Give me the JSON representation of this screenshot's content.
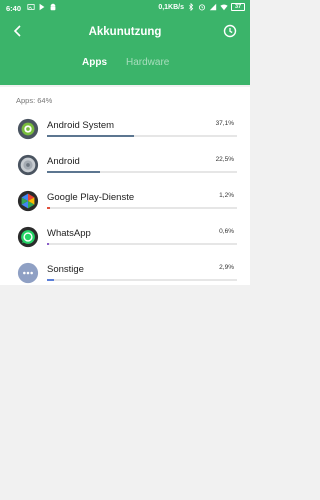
{
  "status_bar": {
    "time": "6:40",
    "speed": "0,1KB/s",
    "battery": "37"
  },
  "header": {
    "title": "Akkunutzung",
    "tabs": [
      {
        "label": "Apps",
        "active": true
      },
      {
        "label": "Hardware",
        "active": false
      }
    ]
  },
  "apps": {
    "summary": "Apps: 64%",
    "items": [
      {
        "name": "Android System",
        "percent": "37,1%",
        "value": 37.1,
        "icon": "android-system-gear-icon",
        "bar_color": "#5c7690"
      },
      {
        "name": "Android",
        "percent": "22,5%",
        "value": 22.5,
        "icon": "android-icon",
        "bar_color": "#5c7690"
      },
      {
        "name": "Google Play-Dienste",
        "percent": "1,2%",
        "value": 1.2,
        "icon": "google-play-services-icon",
        "bar_color": "#e0503c"
      },
      {
        "name": "WhatsApp",
        "percent": "0,6%",
        "value": 0.6,
        "icon": "whatsapp-icon",
        "bar_color": "#8a5ec8"
      },
      {
        "name": "Sonstige",
        "percent": "2,9%",
        "value": 2.9,
        "icon": "others-dots-icon",
        "bar_color": "#5b7fd8"
      }
    ]
  },
  "colors": {
    "header_bg": "#3bb46a",
    "background": "#f1f1f1"
  }
}
